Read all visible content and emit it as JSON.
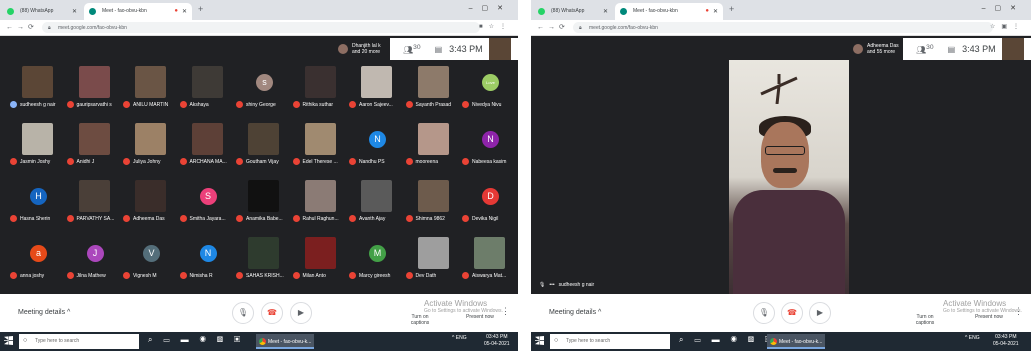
{
  "colors": {
    "meet_bg": "#202124",
    "tab_bg": "#dee1e6",
    "end_call": "#ea4335",
    "taskbar": "#1f2933"
  },
  "left": {
    "tabs": [
      {
        "label": "(88) WhatsApp",
        "color": "#25d366"
      },
      {
        "label": "Meet - fao-obvu-kbn",
        "color": "#00897b",
        "active": true
      }
    ],
    "url": "meet.google.com/fao-obvu-kbn",
    "presenter": {
      "name": "Dhanjith lal k",
      "more": "and 20 more"
    },
    "count": "30",
    "time": "3:43 PM",
    "tiles": [
      {
        "name": "sudheesh g nair",
        "type": "video",
        "color": "#5b4636",
        "speaking": true
      },
      {
        "name": "gauripsarvathi s",
        "type": "video",
        "color": "#7a4b4b"
      },
      {
        "name": "ANILU MARTIN",
        "type": "video",
        "color": "#6a5545"
      },
      {
        "name": "Akshaya",
        "type": "video",
        "color": "#3e3a36"
      },
      {
        "name": "shiny George",
        "type": "letter",
        "letter": "s",
        "color": "#a1887f"
      },
      {
        "name": "Rithika suthar",
        "type": "video",
        "color": "#3a3030"
      },
      {
        "name": "Aaron Sajeev...",
        "type": "video",
        "color": "#c0b8b0"
      },
      {
        "name": "Sayanth Prasad",
        "type": "video",
        "color": "#8d7a6a"
      },
      {
        "name": "Nivedya Nivu",
        "type": "letter",
        "letter": "Love",
        "color": "#9ccc65"
      },
      {
        "name": "Jasmin Joshy",
        "type": "video",
        "color": "#b8b3a8"
      },
      {
        "name": "Anidhi J",
        "type": "video",
        "color": "#6d4c41"
      },
      {
        "name": "Juliya Johny",
        "type": "video",
        "color": "#9c8166"
      },
      {
        "name": "ARCHANA MA...",
        "type": "video",
        "color": "#5d4037"
      },
      {
        "name": "Goutham Vijay",
        "type": "video",
        "color": "#4e4235"
      },
      {
        "name": "Edel Therese ...",
        "type": "video",
        "color": "#a08a70"
      },
      {
        "name": "Nandhu PS",
        "type": "letter",
        "letter": "N",
        "color": "#1e88e5"
      },
      {
        "name": "mooreena",
        "type": "video",
        "color": "#b5978a"
      },
      {
        "name": "Nabeesa kasim",
        "type": "letter",
        "letter": "N",
        "color": "#8e24aa"
      },
      {
        "name": "Hasna Sherin",
        "type": "letter",
        "letter": "H",
        "color": "#1565c0"
      },
      {
        "name": "PARVATHY SA...",
        "type": "video",
        "color": "#4a3f38"
      },
      {
        "name": "Adheema Das",
        "type": "video",
        "color": "#3a2d2a"
      },
      {
        "name": "Smitha Jayara...",
        "type": "letter",
        "letter": "S",
        "color": "#ec407a"
      },
      {
        "name": "Anamika Babe...",
        "type": "video",
        "color": "#111111"
      },
      {
        "name": "Rahul Raghun...",
        "type": "video",
        "color": "#8b7b75"
      },
      {
        "name": "Avanth Ajay",
        "type": "video",
        "color": "#5a5a5a"
      },
      {
        "name": "Shimna 9862",
        "type": "video",
        "color": "#6d5b4c"
      },
      {
        "name": "Devika Nigil",
        "type": "letter",
        "letter": "D",
        "color": "#e53935"
      },
      {
        "name": "anna joshy",
        "type": "letter",
        "letter": "a",
        "color": "#e64a19"
      },
      {
        "name": "Jilna Mathew",
        "type": "letter",
        "letter": "J",
        "color": "#ab47bc"
      },
      {
        "name": "Vignesh M",
        "type": "letter",
        "letter": "V",
        "color": "#546e7a"
      },
      {
        "name": "Nimisha R",
        "type": "letter",
        "letter": "N",
        "color": "#1e88e5"
      },
      {
        "name": "SAHAS KRISH...",
        "type": "video",
        "color": "#2e3b2e"
      },
      {
        "name": "Milan Anto",
        "type": "video",
        "color": "#7b1f1f"
      },
      {
        "name": "Marcy gireesh",
        "type": "letter",
        "letter": "M",
        "color": "#43a047"
      },
      {
        "name": "Dev Dath",
        "type": "video",
        "color": "#9e9e9e"
      },
      {
        "name": "Aiswarya Mat...",
        "type": "video",
        "color": "#6d7d6a"
      }
    ]
  },
  "right": {
    "tabs": [
      {
        "label": "(88) WhatsApp",
        "color": "#25d366"
      },
      {
        "label": "Meet - fao-obvu-kbn",
        "color": "#00897b",
        "active": true
      }
    ],
    "url": "meet.google.com/fao-obvu-kbn",
    "presenter": {
      "name": "Adheema Das",
      "more": "and 55 more"
    },
    "count": "30",
    "time": "3:43 PM",
    "speaker": "sudheesh g nair"
  },
  "bottom": {
    "meeting_details": "Meeting details",
    "captions": "Turn on captions",
    "present": "Present now",
    "activate": "Activate Windows",
    "activate_sub": "Go to Settings to activate Windows."
  },
  "taskbar": {
    "search": "Type here to search",
    "meet_task": "Meet - fao-obvu-k...",
    "lang": "ENG",
    "time": "03:43 PM",
    "date": "05-04-2021"
  }
}
